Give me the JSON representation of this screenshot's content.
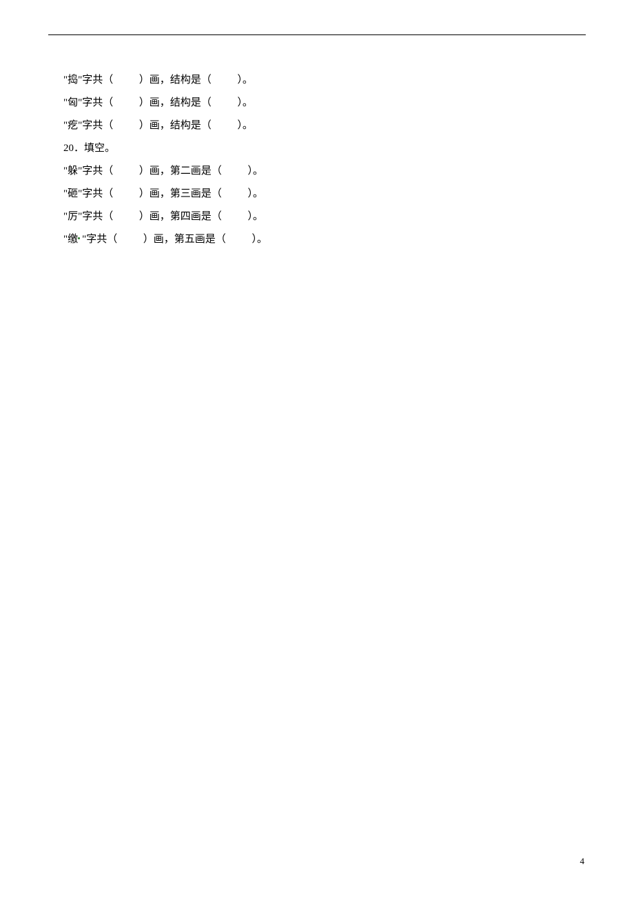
{
  "lines": [
    {
      "char": "捣",
      "mid": "结构是"
    },
    {
      "char": "匈",
      "mid": "结构是"
    },
    {
      "char": "疙",
      "mid": "结构是"
    }
  ],
  "q20": {
    "num": "20",
    "label": "．填空。"
  },
  "lines2": [
    {
      "char": "躲",
      "mid": "第二画是"
    },
    {
      "char": "砸",
      "mid": "第三画是"
    },
    {
      "char": "厉",
      "mid": "第四画是"
    },
    {
      "char": "缴",
      "mid": "第五画是",
      "dot": true
    }
  ],
  "pre": "\"",
  "post": "\"字共（",
  "close1": "）画，",
  "open2": "（",
  "close2": "）。",
  "sp1": "          ",
  "sp2": "          ",
  "page": "4"
}
